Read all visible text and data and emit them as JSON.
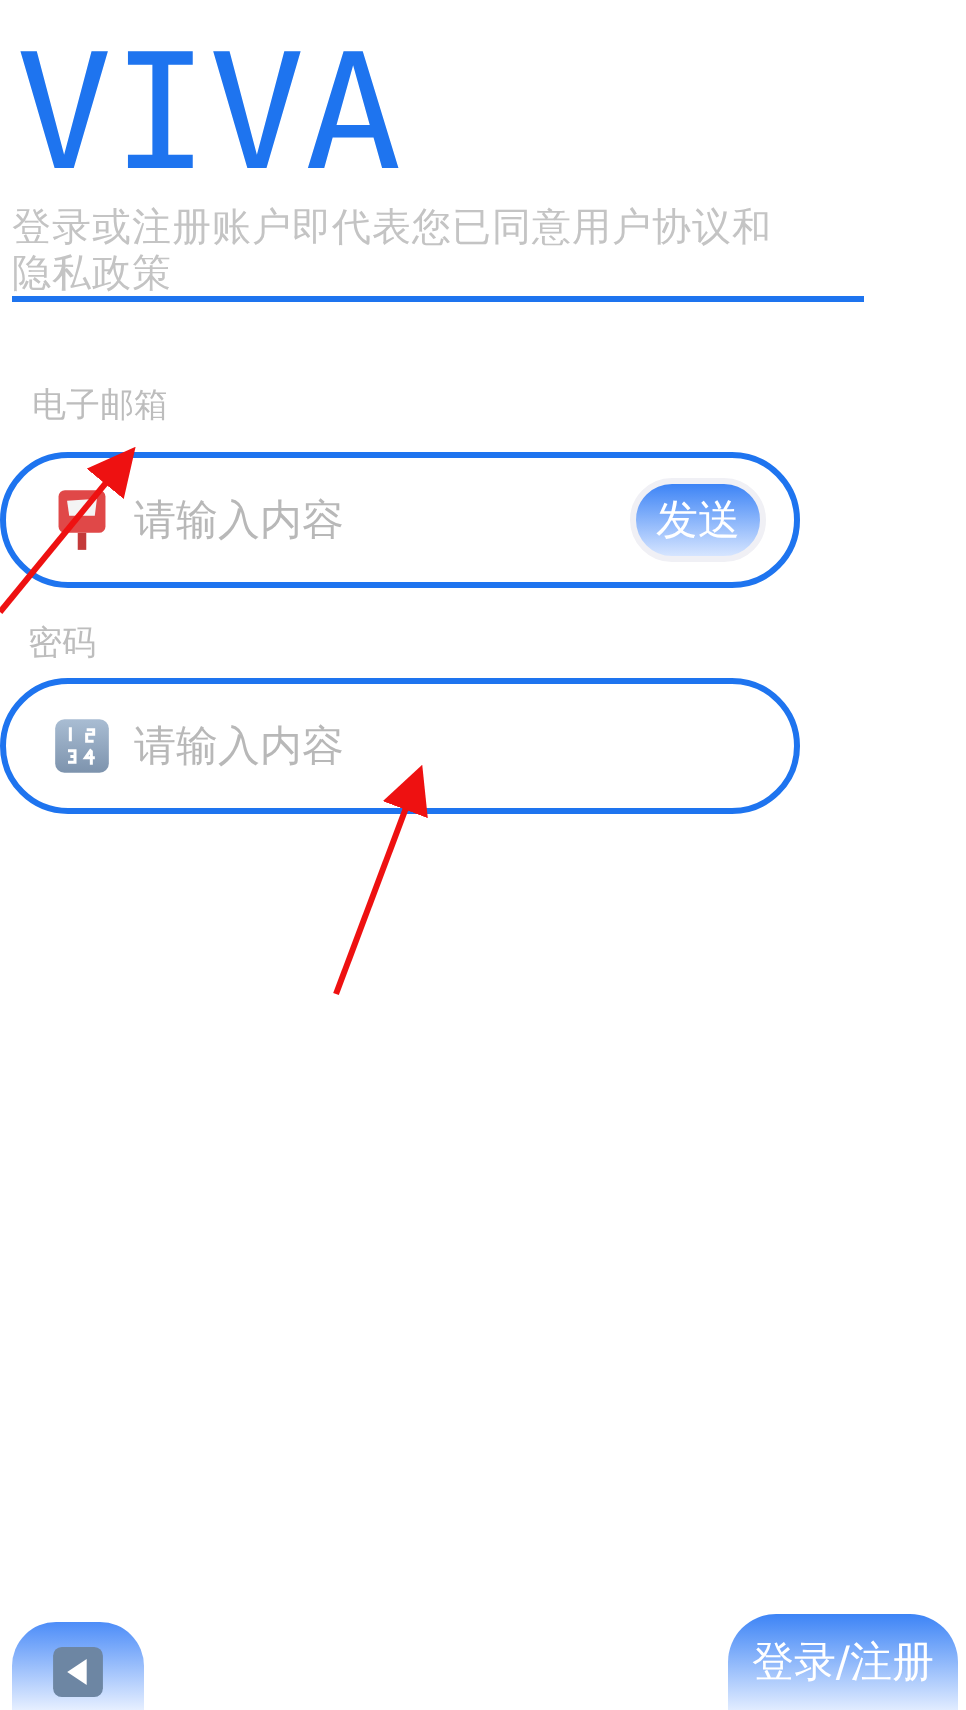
{
  "logo": "VIVA",
  "agreement": "登录或注册账户即代表您已同意用户协议和隐私政策",
  "fields": [
    {
      "label": "电子邮箱",
      "kind": "email",
      "placeholder": "请输入内容",
      "button": "发送"
    },
    {
      "label": "密码",
      "kind": "password",
      "placeholder": "请输入内容"
    }
  ],
  "submit": "登录/注册"
}
